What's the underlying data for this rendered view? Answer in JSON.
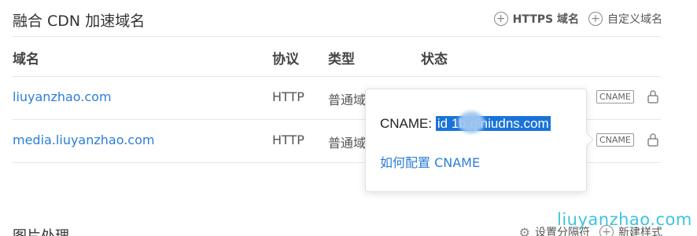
{
  "section": {
    "title": "融合 CDN 加速域名",
    "actions": [
      {
        "icon": "plus-circle-icon",
        "label": "HTTPS 域名"
      },
      {
        "icon": "plus-circle-icon",
        "label": "自定义域名"
      }
    ]
  },
  "table": {
    "columns": [
      "域名",
      "协议",
      "类型",
      "状态"
    ],
    "rows": [
      {
        "domain": "liuyanzhao.com",
        "protocol": "HTTP",
        "type": "普通域",
        "cname_tag": "CNAME"
      },
      {
        "domain": "media.liuyanzhao.com",
        "protocol": "HTTP",
        "type": "普通域",
        "cname_tag": "CNAME"
      }
    ]
  },
  "popover": {
    "cname_label": "CNAME:",
    "cname_value": "id        1b.qiniudns.com",
    "howto_link": "如何配置 CNAME"
  },
  "section2": {
    "title": "图片处理",
    "actions": [
      {
        "icon": "gear-icon",
        "label": "设置分隔符"
      },
      {
        "icon": "plus-circle-icon",
        "label": "新建样式"
      }
    ]
  },
  "watermark": "liuyanzhao.com",
  "colors": {
    "link": "#2b7ed8",
    "selection": "#1a73d9",
    "watermark": "#3ec4de"
  }
}
